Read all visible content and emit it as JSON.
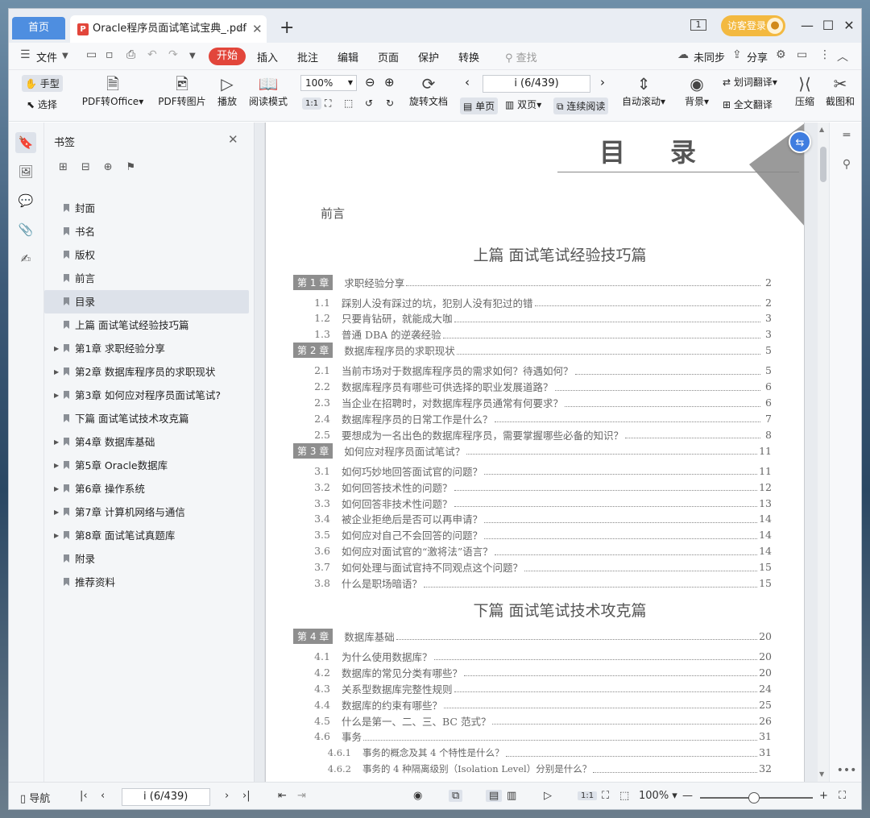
{
  "tabs": {
    "home": "首页",
    "doc_title": "Oracle程序员面试笔试宝典_.pdf",
    "add": "+"
  },
  "titlebar": {
    "login": "访客登录",
    "minimize": "—",
    "maximize": "☐",
    "close": "✕"
  },
  "menu": {
    "file": "文件",
    "start": "开始",
    "items": [
      "插入",
      "批注",
      "编辑",
      "页面",
      "保护",
      "转换"
    ],
    "search": "查找",
    "unsync": "未同步",
    "share": "分享"
  },
  "toolbar": {
    "hand": "手型",
    "select": "选择",
    "pdf_office": "PDF转Office",
    "pdf_image": "PDF转图片",
    "play": "播放",
    "read_mode": "阅读模式",
    "zoom": "100%",
    "rotate": "旋转文档",
    "page": "i (6/439)",
    "single": "单页",
    "double": "双页",
    "continuous": "连续阅读",
    "auto_scroll": "自动滚动",
    "background": "背景",
    "word_translate": "划词翻译",
    "full_translate": "全文翻译",
    "compress": "压缩",
    "screenshot": "截图和"
  },
  "sidebar": {
    "title": "书签",
    "items": [
      {
        "label": "封面",
        "arrow": ""
      },
      {
        "label": "书名",
        "arrow": ""
      },
      {
        "label": "版权",
        "arrow": ""
      },
      {
        "label": "前言",
        "arrow": ""
      },
      {
        "label": "目录",
        "arrow": ""
      },
      {
        "label": "上篇  面试笔试经验技巧篇",
        "arrow": ""
      },
      {
        "label": "第1章  求职经验分享",
        "arrow": "▶"
      },
      {
        "label": "第2章  数据库程序员的求职现状",
        "arrow": "▶"
      },
      {
        "label": "第3章  如何应对程序员面试笔试?",
        "arrow": "▶"
      },
      {
        "label": "下篇  面试笔试技术攻克篇",
        "arrow": ""
      },
      {
        "label": "第4章  数据库基础",
        "arrow": "▶"
      },
      {
        "label": "第5章  Oracle数据库",
        "arrow": "▶"
      },
      {
        "label": "第6章  操作系统",
        "arrow": "▶"
      },
      {
        "label": "第7章  计算机网络与通信",
        "arrow": "▶"
      },
      {
        "label": "第8章  面试笔试真题库",
        "arrow": "▶"
      },
      {
        "label": "附录",
        "arrow": ""
      },
      {
        "label": "推荐资料",
        "arrow": ""
      }
    ]
  },
  "document": {
    "title": "目录",
    "preface": "前言",
    "part1": "上篇    面试笔试经验技巧篇",
    "part2": "下篇    面试笔试技术攻克篇",
    "toc": [
      {
        "kind": "chap",
        "num": "第 1 章",
        "text": "求职经验分享",
        "page": "2"
      },
      {
        "kind": "sec",
        "num": "1.1",
        "text": "踩别人没有踩过的坑，犯别人没有犯过的错",
        "page": "2"
      },
      {
        "kind": "sec",
        "num": "1.2",
        "text": "只要肯钻研，就能成大咖",
        "page": "3"
      },
      {
        "kind": "sec",
        "num": "1.3",
        "text": "普通 DBA 的逆袭经验",
        "page": "3"
      },
      {
        "kind": "chap",
        "num": "第 2 章",
        "text": "数据库程序员的求职现状",
        "page": "5"
      },
      {
        "kind": "sec",
        "num": "2.1",
        "text": "当前市场对于数据库程序员的需求如何？待遇如何？",
        "page": "5"
      },
      {
        "kind": "sec",
        "num": "2.2",
        "text": "数据库程序员有哪些可供选择的职业发展道路？",
        "page": "6"
      },
      {
        "kind": "sec",
        "num": "2.3",
        "text": "当企业在招聘时，对数据库程序员通常有何要求？",
        "page": "6"
      },
      {
        "kind": "sec",
        "num": "2.4",
        "text": "数据库程序员的日常工作是什么？",
        "page": "7"
      },
      {
        "kind": "sec",
        "num": "2.5",
        "text": "要想成为一名出色的数据库程序员，需要掌握哪些必备的知识？",
        "page": "8"
      },
      {
        "kind": "chap",
        "num": "第 3 章",
        "text": "如何应对程序员面试笔试？",
        "page": "11"
      },
      {
        "kind": "sec",
        "num": "3.1",
        "text": "如何巧妙地回答面试官的问题？",
        "page": "11"
      },
      {
        "kind": "sec",
        "num": "3.2",
        "text": "如何回答技术性的问题？",
        "page": "12"
      },
      {
        "kind": "sec",
        "num": "3.3",
        "text": "如何回答非技术性问题？",
        "page": "13"
      },
      {
        "kind": "sec",
        "num": "3.4",
        "text": "被企业拒绝后是否可以再申请？",
        "page": "14"
      },
      {
        "kind": "sec",
        "num": "3.5",
        "text": "如何应对自己不会回答的问题？",
        "page": "14"
      },
      {
        "kind": "sec",
        "num": "3.6",
        "text": "如何应对面试官的“激将法”语言？",
        "page": "14"
      },
      {
        "kind": "sec",
        "num": "3.7",
        "text": "如何处理与面试官持不同观点这个问题？",
        "page": "15"
      },
      {
        "kind": "sec",
        "num": "3.8",
        "text": "什么是职场暗语？",
        "page": "15"
      },
      {
        "kind": "chap",
        "num": "第 4 章",
        "text": "数据库基础",
        "page": "20"
      },
      {
        "kind": "sec",
        "num": "4.1",
        "text": "为什么使用数据库？",
        "page": "20"
      },
      {
        "kind": "sec",
        "num": "4.2",
        "text": "数据库的常见分类有哪些？",
        "page": "20"
      },
      {
        "kind": "sec",
        "num": "4.3",
        "text": "关系型数据库完整性规则",
        "page": "24"
      },
      {
        "kind": "sec",
        "num": "4.4",
        "text": "数据库的约束有哪些？",
        "page": "25"
      },
      {
        "kind": "sec",
        "num": "4.5",
        "text": "什么是第一、二、三、BC 范式？",
        "page": "26"
      },
      {
        "kind": "sec",
        "num": "4.6",
        "text": "事务",
        "page": "31"
      },
      {
        "kind": "sub",
        "num": "4.6.1",
        "text": "事务的概念及其 4 个特性是什么？",
        "page": "31"
      },
      {
        "kind": "sub",
        "num": "4.6.2",
        "text": "事务的 4 种隔离级别（Isolation Level）分别是什么？",
        "page": "32"
      }
    ]
  },
  "statusbar": {
    "nav": "导航",
    "page": "i (6/439)",
    "zoom": "100%"
  }
}
